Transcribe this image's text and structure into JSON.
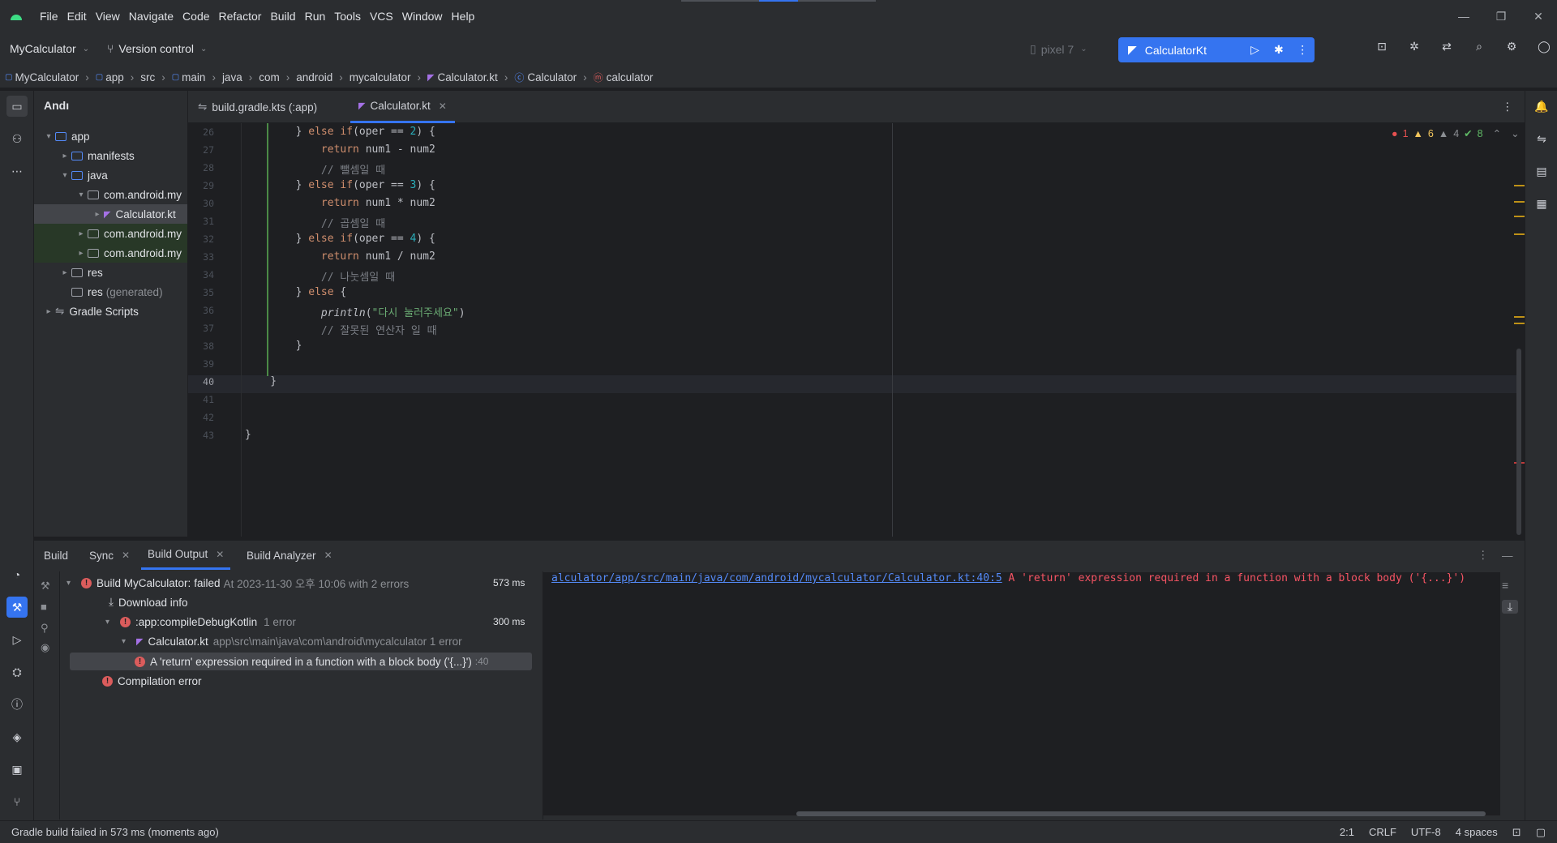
{
  "menu": [
    "File",
    "Edit",
    "View",
    "Navigate",
    "Code",
    "Refactor",
    "Build",
    "Run",
    "Tools",
    "VCS",
    "Window",
    "Help"
  ],
  "toolbar": {
    "project": "MyCalculator",
    "version_control": "Version control",
    "device": "pixel 7",
    "run_config": "CalculatorKt"
  },
  "breadcrumb": [
    "MyCalculator",
    "app",
    "src",
    "main",
    "java",
    "com",
    "android",
    "mycalculator",
    "Calculator.kt",
    "Calculator",
    "calculator"
  ],
  "project_panel": {
    "title": "Andı",
    "tree": [
      {
        "label": "app",
        "depth": 0,
        "open": true
      },
      {
        "label": "manifests",
        "depth": 1,
        "open": false
      },
      {
        "label": "java",
        "depth": 1,
        "open": true
      },
      {
        "label": "com.android.my",
        "depth": 2,
        "open": true
      },
      {
        "label": "Calculator.kt",
        "depth": 3,
        "open": false
      },
      {
        "label": "com.android.my",
        "depth": 2,
        "open": false
      },
      {
        "label": "com.android.my",
        "depth": 2,
        "open": false
      },
      {
        "label": "res",
        "depth": 1,
        "open": false
      },
      {
        "label": "res",
        "suffix": "(generated)",
        "depth": 1
      },
      {
        "label": "Gradle Scripts",
        "depth": 0,
        "open": false
      }
    ]
  },
  "tabs": [
    {
      "label": "build.gradle.kts (:app)",
      "active": false
    },
    {
      "label": "Calculator.kt",
      "active": true
    }
  ],
  "inspections": {
    "errors": "1",
    "warnings": "6",
    "weak": "4",
    "ok": "8"
  },
  "editor": {
    "lines": [
      {
        "n": "26",
        "text": "        } else if(oper == 2) {"
      },
      {
        "n": "27",
        "text": "            return num1 - num2"
      },
      {
        "n": "28",
        "text": "            // 뺄셈일 때"
      },
      {
        "n": "29",
        "text": "        } else if(oper == 3) {"
      },
      {
        "n": "30",
        "text": "            return num1 * num2"
      },
      {
        "n": "31",
        "text": "            // 곱셈일 때"
      },
      {
        "n": "32",
        "text": "        } else if(oper == 4) {"
      },
      {
        "n": "33",
        "text": "            return num1 / num2"
      },
      {
        "n": "34",
        "text": "            // 나눗셈일 때"
      },
      {
        "n": "35",
        "text": "        } else {"
      },
      {
        "n": "36",
        "text": "            println(\"다시 눌러주세요\")"
      },
      {
        "n": "37",
        "text": "            // 잘못된 연산자 일 때"
      },
      {
        "n": "38",
        "text": "        }"
      },
      {
        "n": "39",
        "text": ""
      },
      {
        "n": "40",
        "text": "    }"
      },
      {
        "n": "41",
        "text": ""
      },
      {
        "n": "42",
        "text": ""
      },
      {
        "n": "43",
        "text": "}"
      }
    ]
  },
  "build_panel": {
    "tabs": [
      "Build",
      "Sync",
      "Build Output",
      "Build Analyzer"
    ],
    "tree": {
      "root": "Build MyCalculator:",
      "root_status": "failed",
      "root_info": "At 2023-11-30 오후 10:06 with 2 errors",
      "root_time": "573 ms",
      "download": "Download info",
      "task": ":app:compileDebugKotlin",
      "task_info": "1 error",
      "task_time": "300 ms",
      "file": "Calculator.kt",
      "file_info": "app\\src\\main\\java\\com\\android\\mycalculator 1 error",
      "error": "A 'return' expression required in a function with a block body ('{...}')",
      "error_loc": ":40",
      "compilation": "Compilation error"
    },
    "console_link": "alculator/app/src/main/java/com/android/mycalculator/Calculator.kt:40:5",
    "console_msg": "A 'return' expression required in a function with a block body ('{...}')"
  },
  "status": {
    "message": "Gradle build failed in 573 ms (moments ago)",
    "position": "2:1",
    "line_sep": "CRLF",
    "encoding": "UTF-8",
    "indent": "4 spaces"
  },
  "colors": {
    "accent": "#3574f0",
    "error": "#db5c5c",
    "warning": "#f2c55c",
    "keyword": "#cf8e6d"
  }
}
